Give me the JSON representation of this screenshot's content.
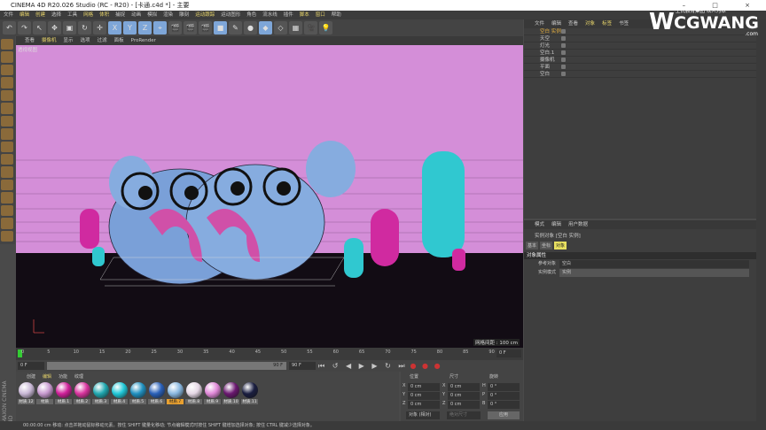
{
  "title": "CINEMA 4D R20.026 Studio (RC - R20) - [卡通.c4d *] - 主要",
  "window_controls": "– □ ×",
  "menu": [
    "文件",
    "编辑",
    "创建",
    "选择",
    "工具",
    "网格",
    "体积",
    "捕捉",
    "动画",
    "模拟",
    "渲染",
    "雕刻",
    "运动跟踪",
    "运动图形",
    "角色",
    "流水线",
    "插件",
    "脚本",
    "窗口",
    "帮助"
  ],
  "toolbar": [
    "↶",
    "↷",
    "↖",
    "✥",
    "▣",
    "↻",
    "✛",
    "X",
    "Y",
    "Z",
    "⌖",
    "🎬",
    "🎬",
    "🎬",
    "■",
    "✎",
    "●",
    "◆",
    "◇",
    "▦",
    "🎥",
    "💡"
  ],
  "viewport": {
    "tabs": [
      "查看",
      "摄像机",
      "显示",
      "选项",
      "过滤",
      "面板",
      "ProRender"
    ],
    "label": "透视视图",
    "grid": "网格间距 : 100 cm"
  },
  "timeline": {
    "ticks": [
      "0",
      "5",
      "10",
      "15",
      "20",
      "25",
      "30",
      "35",
      "40",
      "45",
      "50",
      "55",
      "60",
      "65",
      "70",
      "75",
      "80",
      "85",
      "90"
    ],
    "end_field": "0 F",
    "start": "0 F",
    "range_end": "90 F",
    "range_end2": "90 F"
  },
  "materials": {
    "tabs": [
      "创建",
      "编辑",
      "功能",
      "纹理"
    ],
    "items": [
      {
        "name": "材质.12",
        "color": "#c9b8d6"
      },
      {
        "name": "材质",
        "color": "#c89ad0"
      },
      {
        "name": "材质.1",
        "color": "#d0209a"
      },
      {
        "name": "材质.2",
        "color": "#d8349e"
      },
      {
        "name": "材质.3",
        "color": "#20a8b0"
      },
      {
        "name": "材质.4",
        "color": "#20c8d8"
      },
      {
        "name": "材质.5",
        "color": "#2090c0"
      },
      {
        "name": "材质.6",
        "color": "#2a60b8"
      },
      {
        "name": "材质.7",
        "color": "#8ab8e0"
      },
      {
        "name": "材质.8",
        "color": "#e6d8e6"
      },
      {
        "name": "材质.9",
        "color": "#e088d8"
      },
      {
        "name": "材质.10",
        "color": "#6a1870"
      },
      {
        "name": "材质.11",
        "color": "#1a1e40"
      }
    ]
  },
  "coords": {
    "headers": [
      "位置",
      "尺寸",
      "旋转"
    ],
    "rows": [
      [
        "X",
        "0 cm",
        "X",
        "0 cm",
        "H",
        "0 °"
      ],
      [
        "Y",
        "0 cm",
        "Y",
        "0 cm",
        "P",
        "0 °"
      ],
      [
        "Z",
        "0 cm",
        "Z",
        "0 cm",
        "B",
        "0 °"
      ]
    ],
    "mode": "对象 (相对)",
    "size_mode": "绝对尺寸",
    "apply": "应用"
  },
  "status": "00:00:00 cm   移动: 点击并拖动鼠标移动元素。按住 SHIFT 键量化移动; 节点编辑模式时按住 SHIFT 键增加选择对象; 按住 CTRL 键减少选择对象。",
  "objects": {
    "menu": [
      "文件",
      "编辑",
      "查看",
      "对象",
      "标签",
      "书签"
    ],
    "items": [
      "空白 实例",
      "天空",
      "灯光",
      "空白.1",
      "摄像机",
      "平面",
      "空白"
    ]
  },
  "attributes": {
    "menu": [
      "模式",
      "编辑",
      "用户数据"
    ],
    "object": "实例对象 [空白 实例]",
    "tabs": [
      "基本",
      "坐标",
      "对象"
    ],
    "section": "对象属性",
    "fields": [
      {
        "label": "参考对象",
        "value": "空白"
      },
      {
        "label": "实例模式",
        "value": "实例"
      }
    ]
  },
  "logo": {
    "brand": "CGWANG",
    "sub": "王氏教育集团 以人为本",
    "dotcom": ".com"
  },
  "side_brand": "MAXON CINEMA 4D"
}
